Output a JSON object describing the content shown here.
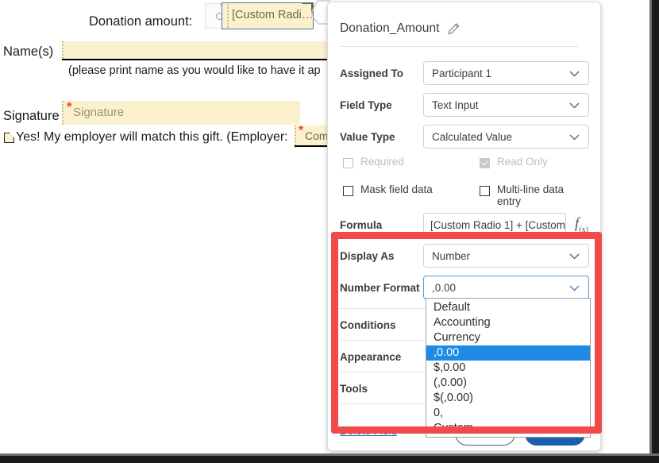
{
  "document": {
    "donation_label": "Donation amount:",
    "names_label": "Name(s)",
    "print_note": "(please print name as you would like to have it ap",
    "signature_label": "Signature",
    "signature_field_text": "Signature",
    "employer_line": "Yes!  My employer will match this gift.  (Employer:",
    "employer_field_text": "Comp",
    "radio_field_text": "[Custom Radi…",
    "required_marker": "*"
  },
  "panel": {
    "title": "Donation_Amount",
    "edit_icon": "pencil-icon",
    "properties": [
      {
        "label": "Assigned To",
        "value": "Participant 1"
      },
      {
        "label": "Field Type",
        "value": "Text Input"
      },
      {
        "label": "Value Type",
        "value": "Calculated Value"
      }
    ],
    "checkboxes": [
      {
        "label": "Required",
        "checked": false,
        "disabled": true
      },
      {
        "label": "Read Only",
        "checked": true,
        "disabled": true
      },
      {
        "label": "Mask field data",
        "checked": false,
        "disabled": false
      },
      {
        "label": "Multi-line data entry",
        "checked": false,
        "disabled": false
      }
    ],
    "formula": {
      "label": "Formula",
      "value": "[Custom Radio 1] + [Custom…",
      "fx_icon": "fx-icon",
      "fx_text": "f",
      "fx_sub": "(x)"
    },
    "display_as": {
      "label": "Display As",
      "value": "Number"
    },
    "number_format": {
      "label": "Number Format",
      "value": ",0.00"
    },
    "sections": [
      {
        "label": "Conditions"
      },
      {
        "label": "Appearance"
      },
      {
        "label": "Tools"
      }
    ],
    "delete_link": "Delete Field",
    "buttons": {
      "cancel": "",
      "save": ""
    }
  },
  "dropdown": {
    "name": "number-format-options",
    "selected": ",0.00",
    "options": [
      "Default",
      "Accounting",
      "Currency",
      ",0.00",
      "$,0.00",
      "(,0.00)",
      "$(,0.00)",
      "0,",
      "Custom"
    ]
  },
  "colors": {
    "highlight_red": "#f04a4a",
    "dropdown_selected": "#1e8ae5",
    "form_field_cream": "#fbf2cd",
    "link_blue": "#2a6fb5",
    "save_button_blue": "#1b5faa",
    "selection_border": "#4a7f9c",
    "field_corner_olive": "#6d6324",
    "tag_pink": "#f061c0"
  }
}
